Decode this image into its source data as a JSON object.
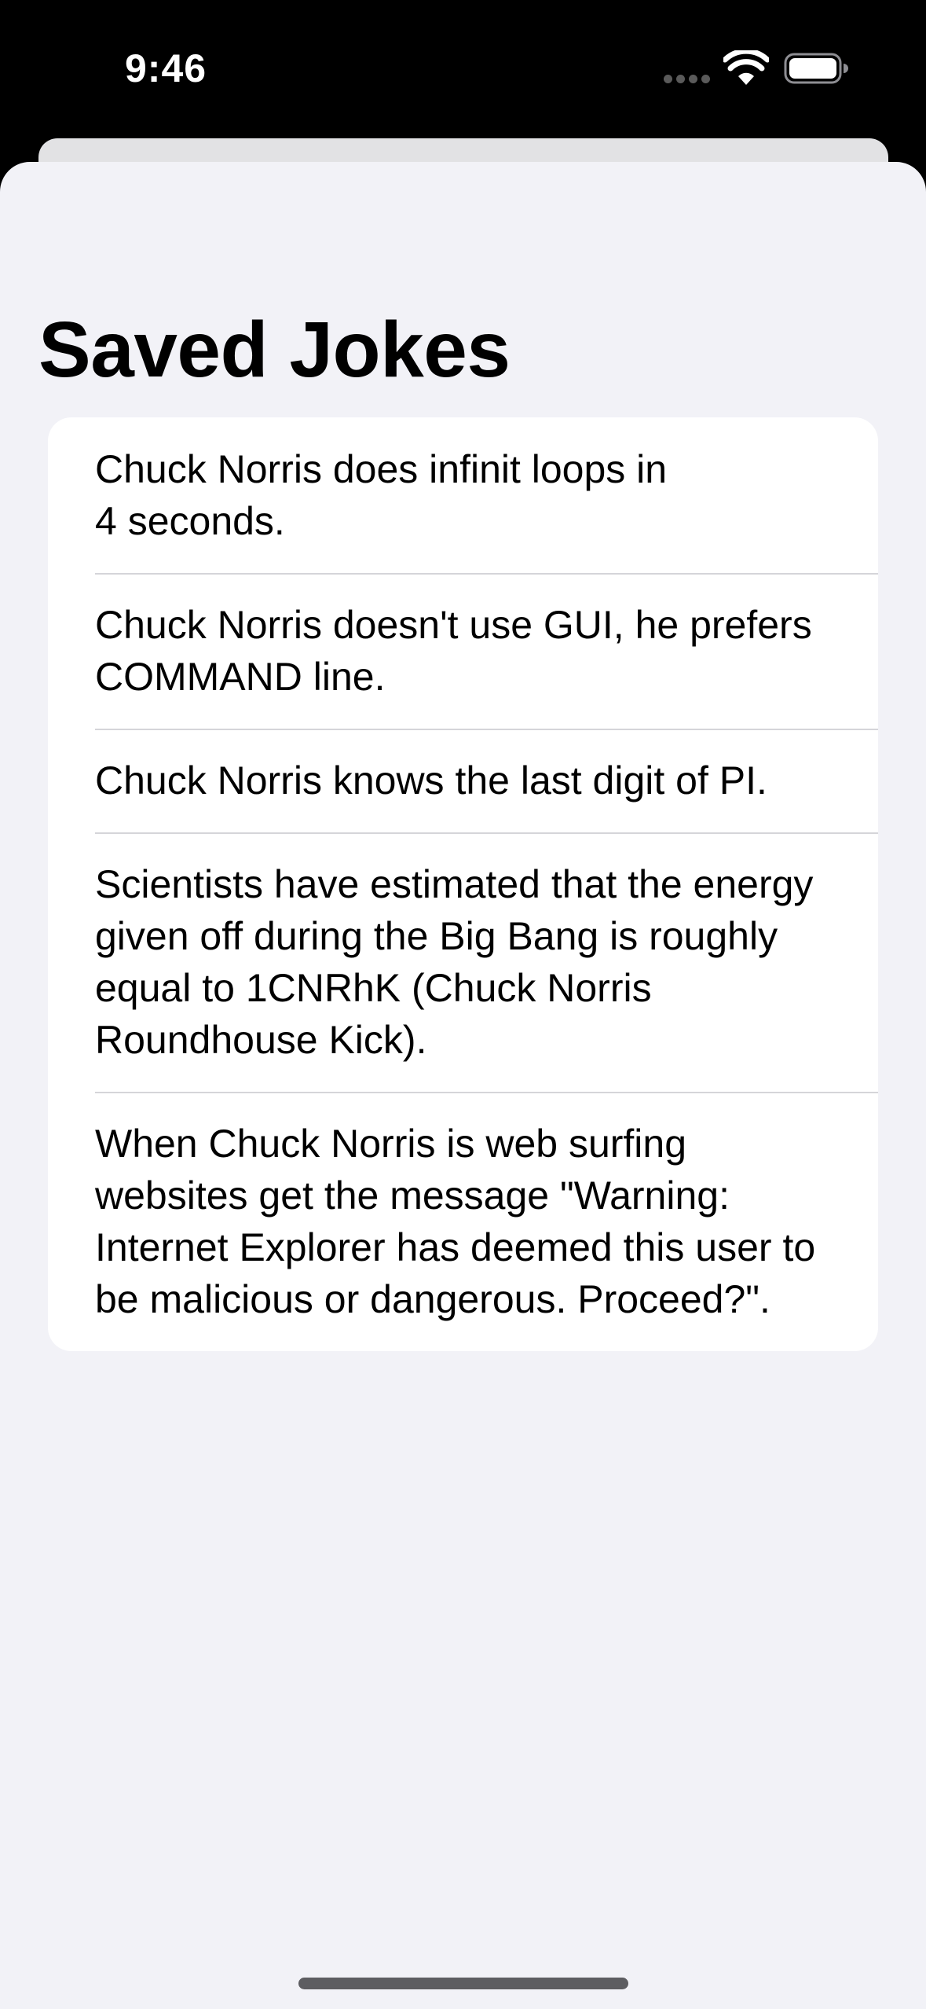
{
  "status_bar": {
    "time": "9:46"
  },
  "page": {
    "title": "Saved Jokes"
  },
  "jokes": [
    "Chuck Norris does infinit loops in\n4 seconds.",
    "Chuck Norris doesn't use GUI, he prefers COMMAND line.",
    "Chuck Norris knows the last digit of PI.",
    "Scientists have estimated that the energy given off during the Big Bang is roughly equal to 1CNRhK (Chuck Norris Roundhouse Kick).",
    "When Chuck Norris is web surfing websites get the message \"Warning: Internet Explorer has deemed this user to be malicious or dangerous. Proceed?\"."
  ]
}
